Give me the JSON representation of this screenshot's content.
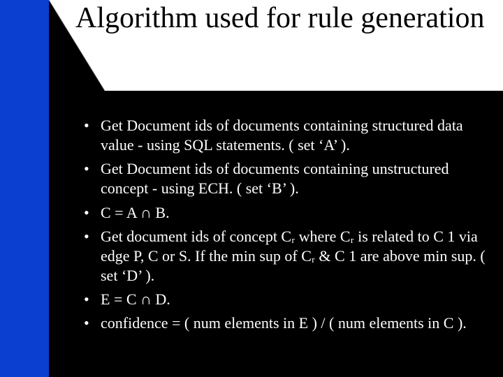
{
  "title": "Algorithm used for rule generation",
  "bullets": [
    "Get Document ids of documents containing structured data value - using SQL statements. ( set ‘A’ ).",
    "Get Document ids of documents containing unstructured concept - using ECH. ( set ‘B’ ).",
    "C = A ∩ B.",
    "Get document ids of concept Cᵣ where Cᵣ is related to C 1 via edge P, C or S. If the min sup of Cᵣ & C 1 are above min sup. ( set ‘D’ ).",
    "E = C ∩ D.",
    "confidence = ( num elements in E ) / ( num elements in C )."
  ],
  "colors": {
    "blue": "#0b3fd0",
    "black": "#000000",
    "white": "#ffffff"
  }
}
